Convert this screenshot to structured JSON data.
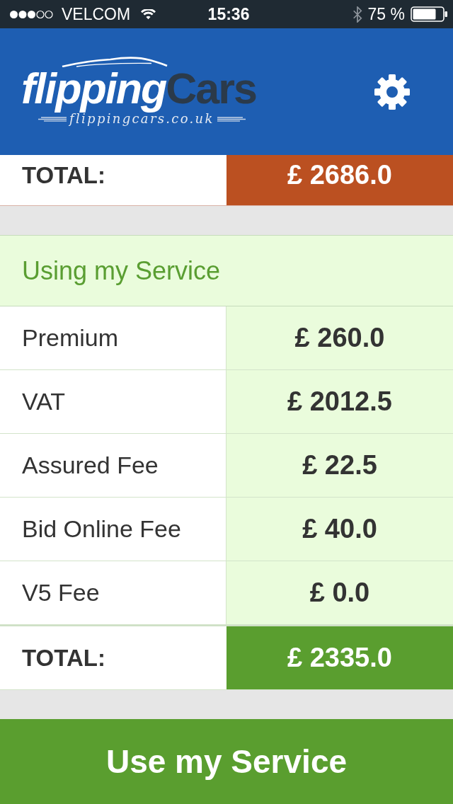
{
  "status_bar": {
    "carrier": "VELCOM",
    "time": "15:36",
    "battery": "75 %"
  },
  "header": {
    "logo": {
      "wordmark": [
        "flipping",
        "Cars"
      ],
      "tagline": "flippingcars.co.uk"
    }
  },
  "previous_total": {
    "label": "TOTAL:",
    "value": "£ 2686.0"
  },
  "section": {
    "title": "Using my Service",
    "rows": [
      {
        "label": "Premium",
        "value": "£ 260.0"
      },
      {
        "label": "VAT",
        "value": "£ 2012.5"
      },
      {
        "label": "Assured Fee",
        "value": "£ 22.5"
      },
      {
        "label": "Bid Online Fee",
        "value": "£ 40.0"
      },
      {
        "label": "V5 Fee",
        "value": "£ 0.0"
      }
    ],
    "total": {
      "label": "TOTAL:",
      "value": "£ 2335.0"
    }
  },
  "action_button": {
    "label": "Use my Service"
  }
}
